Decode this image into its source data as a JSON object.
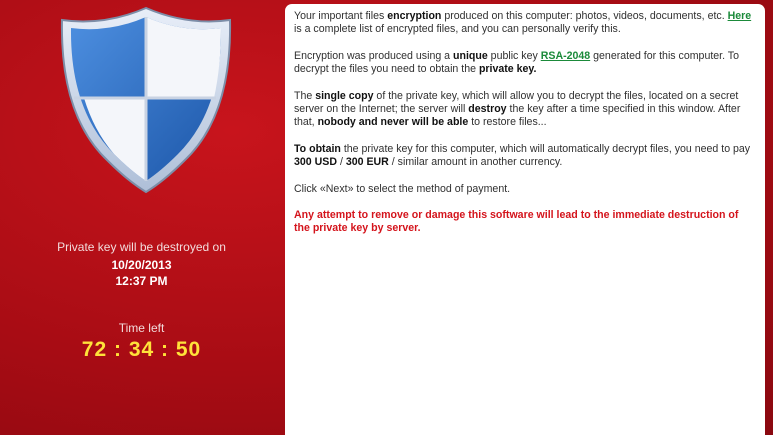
{
  "colors": {
    "background_red": "#b40e16",
    "panel_white": "#ffffff",
    "timer_yellow": "#ffe23a",
    "link_green": "#1b8a3a",
    "warning_red": "#d4141c",
    "shield_blue": "#2a6fc9"
  },
  "left": {
    "shield_icon": "shield-icon",
    "destroy_label": "Private key will be destroyed on",
    "destroy_date": "10/20/2013",
    "destroy_time": "12:37 PM",
    "time_left_label": "Time left",
    "timer": "72 : 34 : 50"
  },
  "message": {
    "p1_a": "Your important files ",
    "p1_b": "encryption",
    "p1_c": " produced on this computer: photos, videos, documents, etc. ",
    "p1_link": "Here",
    "p1_d": " is a complete list of encrypted files, and you can personally verify this.",
    "p2_a": "Encryption was produced using a ",
    "p2_b": "unique",
    "p2_c": " public key ",
    "p2_link": "RSA-2048",
    "p2_d": " generated for this computer. To decrypt the files you need to obtain the ",
    "p2_e": "private key.",
    "p3_a": "The ",
    "p3_b": "single copy",
    "p3_c": " of the private key, which will allow you to decrypt the files, located on a secret server on the Internet; the server will ",
    "p3_d": "destroy",
    "p3_e": " the key after a time specified in this window. After that, ",
    "p3_f": "nobody and never will be able",
    "p3_g": " to restore files...",
    "p4_a": "To obtain",
    "p4_b": " the private key for this computer, which will automatically decrypt files, you need to pay ",
    "p4_c": "300 USD",
    "p4_d": " / ",
    "p4_e": "300 EUR",
    "p4_f": " / similar amount in another currency.",
    "p5": "Click «Next» to select the method of payment.",
    "warning": "Any attempt to remove or damage this software will lead to the immediate destruction of the private key by server."
  }
}
